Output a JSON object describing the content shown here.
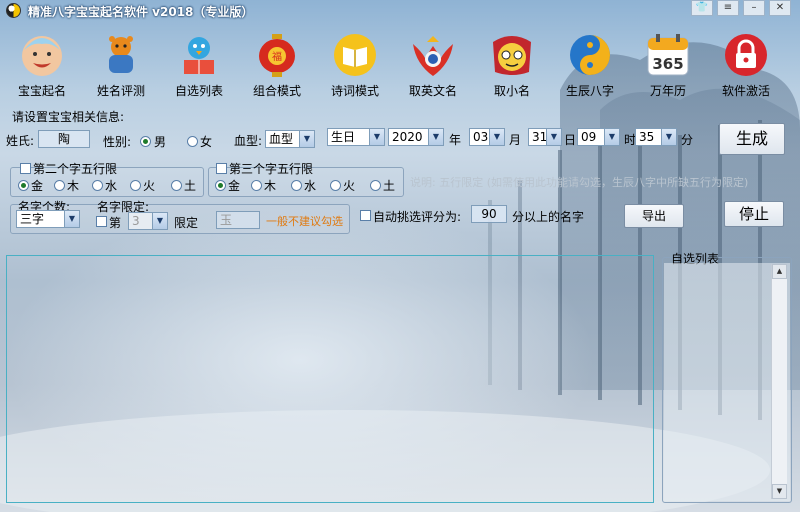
{
  "window": {
    "title": "精准八字宝宝起名软件 v2018（专业版）"
  },
  "toolbar": {
    "items": [
      {
        "label": "宝宝起名",
        "icon": "baby-face-icon"
      },
      {
        "label": "姓名评测",
        "icon": "bear-figure-icon"
      },
      {
        "label": "自选列表",
        "icon": "bird-reading-icon"
      },
      {
        "label": "组合模式",
        "icon": "lantern-icon"
      },
      {
        "label": "诗词模式",
        "icon": "book-icon"
      },
      {
        "label": "取英文名",
        "icon": "eagle-emblem-icon"
      },
      {
        "label": "取小名",
        "icon": "cartoon-face-icon"
      },
      {
        "label": "生辰八字",
        "icon": "yin-yang-icon"
      },
      {
        "label": "万年历",
        "icon": "calendar-365-icon"
      },
      {
        "label": "软件激活",
        "icon": "lock-icon"
      }
    ]
  },
  "settings": {
    "legend": "请设置宝宝相关信息:",
    "surname_label": "姓氏:",
    "surname_value": "陶",
    "gender_label": "性别:",
    "gender_male": "男",
    "gender_female": "女",
    "blood_label": "血型:",
    "blood_value": "血型",
    "birthday_value": "生日",
    "year_value": "2020",
    "year_unit": "年",
    "month_value": "03",
    "month_unit": "月",
    "day_value": "31",
    "day_unit": "日",
    "hour_value": "09",
    "hour_unit": "时",
    "minute_value": "35",
    "minute_unit": "分",
    "generate_button": "生成",
    "second_char_label": "第二个字五行限",
    "third_char_label": "第三个字五行限",
    "elements": [
      "金",
      "木",
      "水",
      "火",
      "土"
    ],
    "note": "说明: 五行限定 (如需使用此功能请勾选，生辰八字中所缺五行为限定)",
    "name_count_label": "名字个数:",
    "name_count_value": "三字",
    "name_limit_label": "名字限定:",
    "limit_position_label": "第",
    "limit_position_value": "3",
    "limit_label": "限定",
    "limit_value": "玉",
    "limit_hint": "一般不建议勾选",
    "auto_select_label": "自动挑选评分为:",
    "auto_select_score": "90",
    "auto_select_suffix": "分以上的名字",
    "export_button": "导出",
    "stop_button": "停止"
  },
  "list_panel": {
    "legend": "自选列表"
  },
  "colors": {
    "accent": "#49b0c4",
    "hint_orange": "#e07a10"
  }
}
